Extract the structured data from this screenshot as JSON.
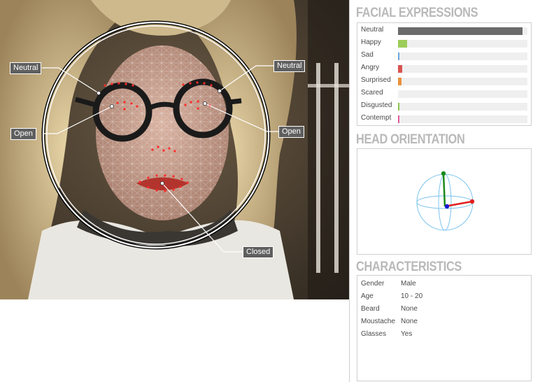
{
  "sections": {
    "expressions_title": "FACIAL EXPRESSIONS",
    "orientation_title": "HEAD ORIENTATION",
    "characteristics_title": "CHARACTERISTICS"
  },
  "callouts": {
    "left_eyebrow": "Neutral",
    "right_eyebrow": "Neutral",
    "left_eye": "Open",
    "right_eye": "Open",
    "mouth": "Closed"
  },
  "expressions": [
    {
      "label": "Neutral",
      "value": 0.96,
      "color": "#6b6b6b"
    },
    {
      "label": "Happy",
      "value": 0.07,
      "color": "#9ccc59"
    },
    {
      "label": "Sad",
      "value": 0.005,
      "color": "#6aa6d8"
    },
    {
      "label": "Angry",
      "value": 0.03,
      "color": "#d9534f"
    },
    {
      "label": "Surprised",
      "value": 0.025,
      "color": "#e8913a"
    },
    {
      "label": "Scared",
      "value": 0.0,
      "color": "#b37fd6"
    },
    {
      "label": "Disgusted",
      "value": 0.005,
      "color": "#8bc34a"
    },
    {
      "label": "Contempt",
      "value": 0.005,
      "color": "#e05a9a"
    }
  ],
  "characteristics": [
    {
      "key": "Gender",
      "value": "Male"
    },
    {
      "key": "Age",
      "value": "10 - 20"
    },
    {
      "key": "Beard",
      "value": "None"
    },
    {
      "key": "Moustache",
      "value": "None"
    },
    {
      "key": "Glasses",
      "value": "Yes"
    }
  ],
  "colors": {
    "axis_x": "#e02020",
    "axis_y": "#1a8a1a",
    "axis_z": "#1a1ad0",
    "sphere": "#7cc4ee",
    "landmark": "#ff2a2a"
  }
}
